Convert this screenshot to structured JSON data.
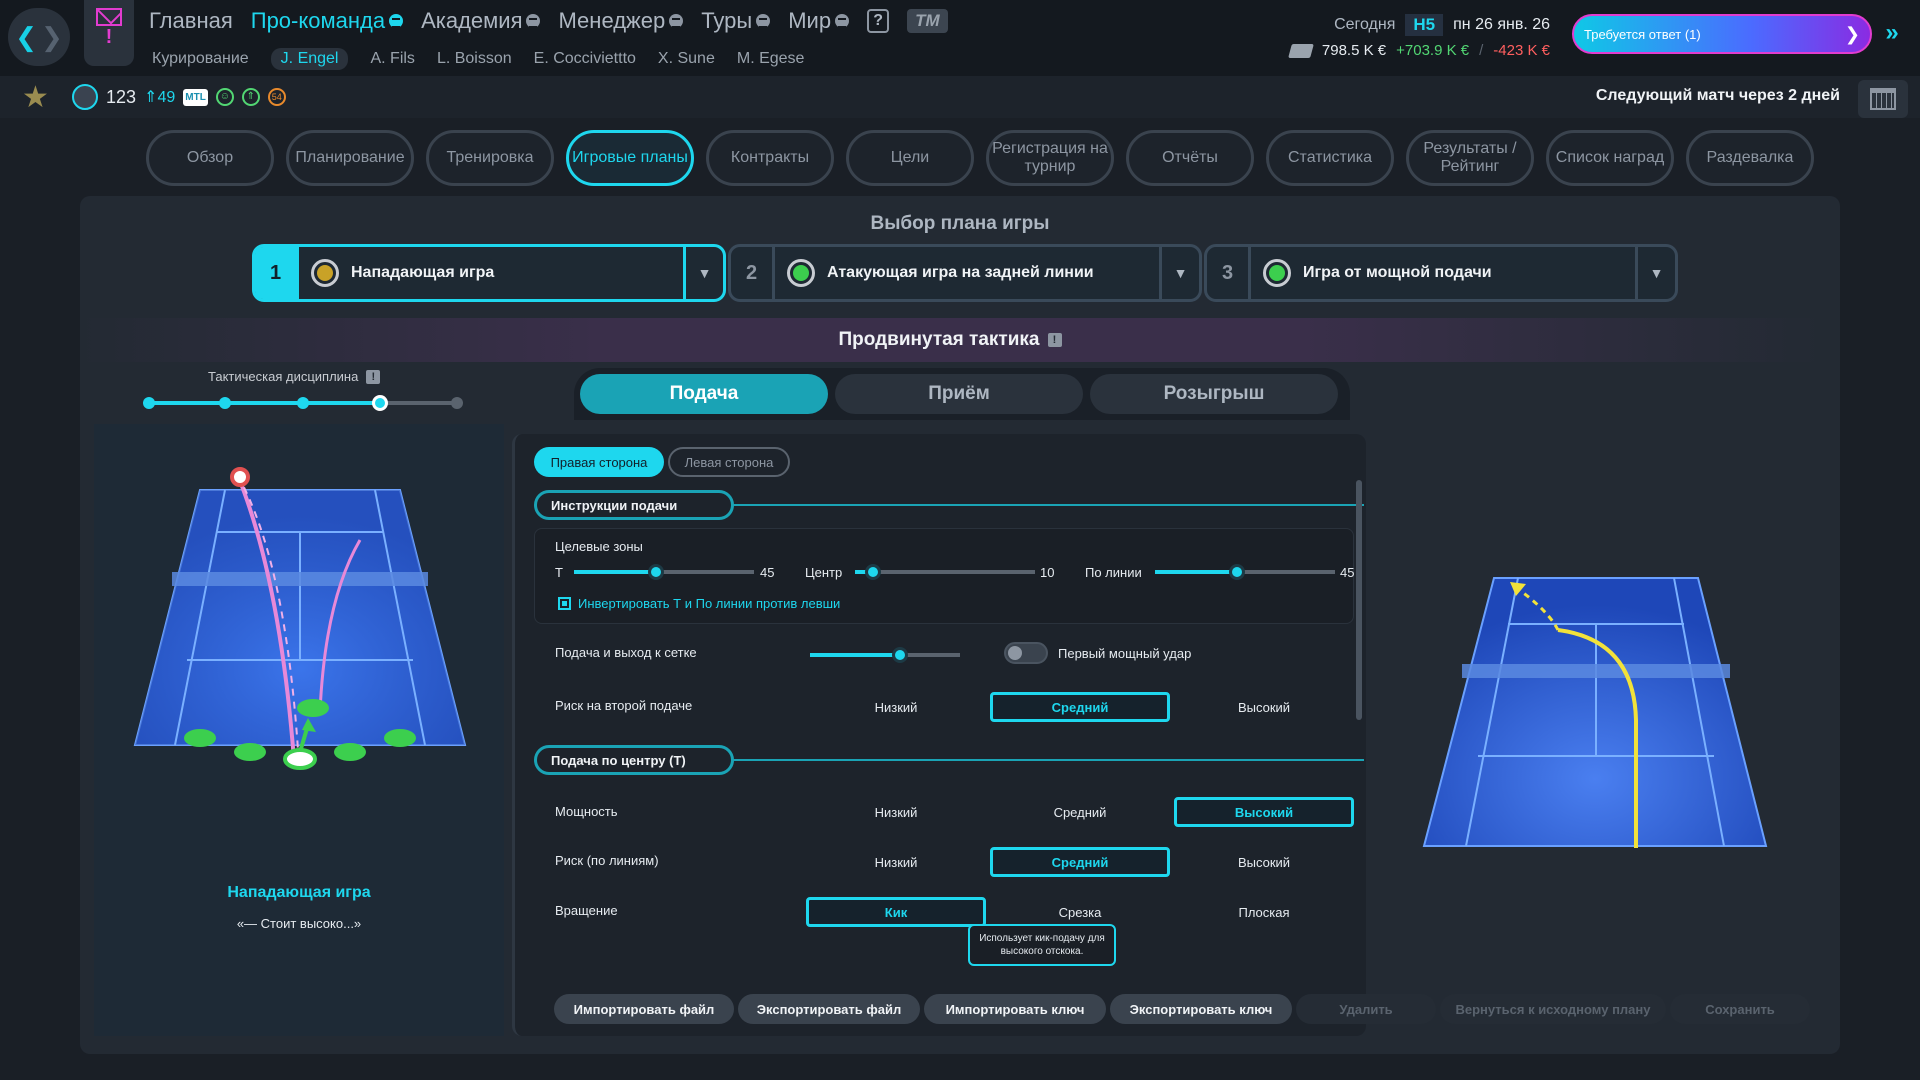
{
  "topnav": {
    "items": [
      {
        "label": "Главная",
        "menu": false
      },
      {
        "label": "Про-команда",
        "menu": true,
        "active": true
      },
      {
        "label": "Академия",
        "menu": true
      },
      {
        "label": "Менеджер",
        "menu": true
      },
      {
        "label": "Туры",
        "menu": true
      },
      {
        "label": "Мир",
        "menu": true
      }
    ],
    "help": "?",
    "logo": "TM"
  },
  "subnav": [
    "Курирование",
    "J. Engel",
    "A. Fils",
    "L. Boisson",
    "E. Cocciviettto",
    "X. Sune",
    "M. Egese"
  ],
  "status": {
    "today_label": "Сегодня",
    "week": "Н5",
    "date": "пн 26 янв. 26",
    "balance": "798.5 K €",
    "income": "+703.9 K €",
    "expense": "-423 K €",
    "reply_label": "Требуется ответ (1)"
  },
  "player": {
    "rank": "123",
    "rank_change": "49",
    "tour": "MTL",
    "fatigue": "54"
  },
  "next_match": "Следующий матч через 2 дней",
  "tabs": [
    "Обзор",
    "Планирование",
    "Тренировка",
    "Игровые планы",
    "Контракты",
    "Цели",
    "Регистрация на турнир",
    "Отчёты",
    "Статистика",
    "Результаты / Рейтинг",
    "Список наград",
    "Раздевалка"
  ],
  "active_tab": "Игровые планы",
  "plan_select_title": "Выбор плана игры",
  "plans": [
    {
      "num": "1",
      "name": "Нападающая игра",
      "color": "#c9a227",
      "selected": true
    },
    {
      "num": "2",
      "name": "Атакующая игра на задней линии",
      "color": "#3ccf4e",
      "selected": false
    },
    {
      "num": "3",
      "name": "Игра от мощной подачи",
      "color": "#3ccf4e",
      "selected": false
    }
  ],
  "advanced_title": "Продвинутая тактика",
  "discipline": {
    "label": "Тактическая дисциплина",
    "level": 4,
    "levels": 5
  },
  "phases": [
    "Подача",
    "Приём",
    "Розыгрыш"
  ],
  "active_phase": "Подача",
  "left_panel": {
    "title": "Нападающая игра",
    "quote": "«— Стоит высоко...»"
  },
  "sides": [
    "Правая сторона",
    "Левая сторона"
  ],
  "serve_instructions": {
    "title": "Инструкции подачи",
    "zones_label": "Целевые зоны",
    "zones": [
      {
        "label": "Т",
        "value": 45
      },
      {
        "label": "Центр",
        "value": 10
      },
      {
        "label": "По линии",
        "value": 45
      }
    ],
    "invert_label": "Инвертировать Т и По линии против левши",
    "net_label": "Подача и выход к сетке",
    "net_value": 0.6,
    "power_toggle_label": "Первый мощный удар",
    "risk2_label": "Риск на второй подаче",
    "risk2_options": [
      "Низкий",
      "Средний",
      "Высокий"
    ],
    "risk2_selected": "Средний"
  },
  "center_serve": {
    "title": "Подача по центру (T)",
    "power_label": "Мощность",
    "power_options": [
      "Низкий",
      "Средний",
      "Высокий"
    ],
    "power_selected": "Высокий",
    "risk_label": "Риск (по линиям)",
    "risk_options": [
      "Низкий",
      "Средний",
      "Высокий"
    ],
    "risk_selected": "Средний",
    "spin_label": "Вращение",
    "spin_options": [
      "Кик",
      "Срезка",
      "Плоская"
    ],
    "spin_selected": "Кик",
    "tooltip": "Использует кик-подачу для высокого отскока."
  },
  "buttons": [
    {
      "label": "Импортировать файл",
      "enabled": true
    },
    {
      "label": "Экспортировать файл",
      "enabled": true
    },
    {
      "label": "Импортировать ключ",
      "enabled": true
    },
    {
      "label": "Экспортировать ключ",
      "enabled": true
    },
    {
      "label": "Удалить",
      "enabled": false
    },
    {
      "label": "Вернуться к исходному плану",
      "enabled": false
    },
    {
      "label": "Сохранить",
      "enabled": false
    }
  ],
  "colors": {
    "accent": "#1ed7ee",
    "court": "#2c5fd6",
    "alert": "#e23ccf"
  }
}
